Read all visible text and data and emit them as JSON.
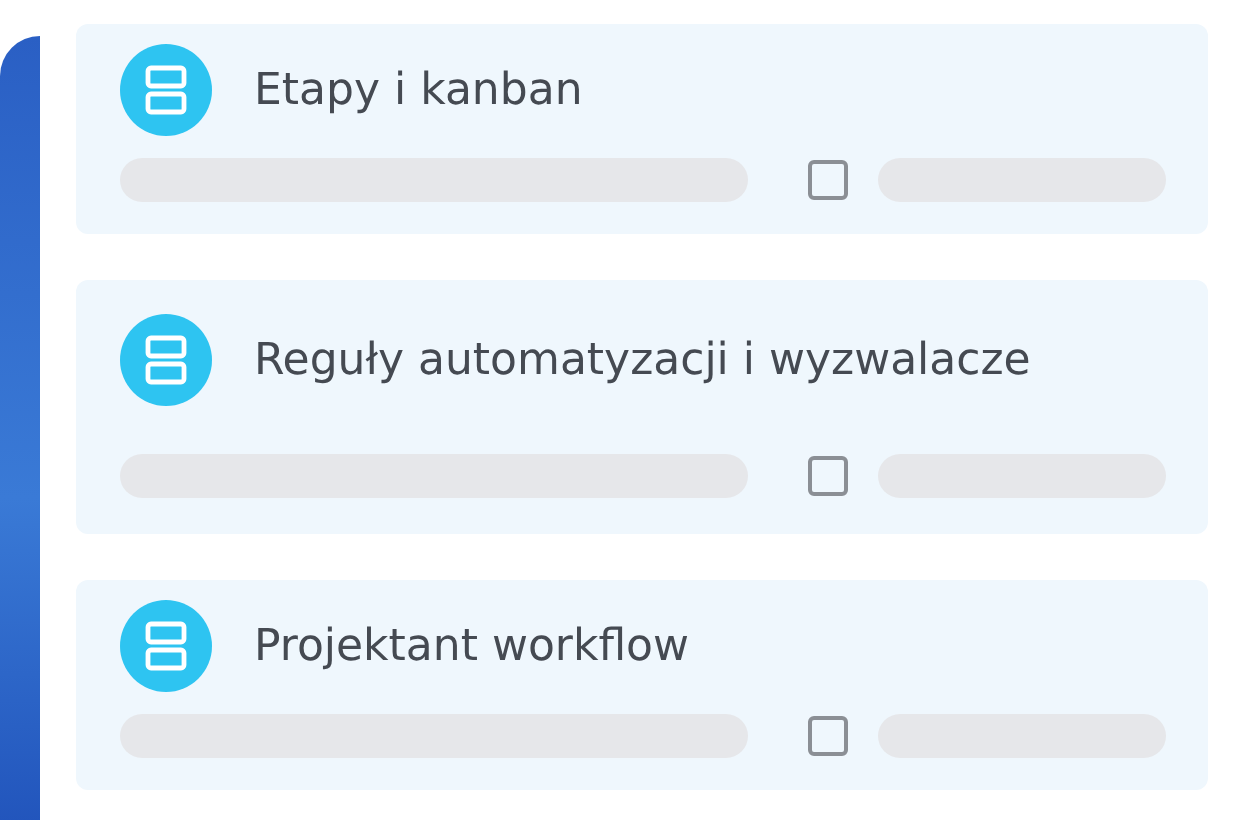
{
  "cards": [
    {
      "title": "Etapy i kanban",
      "checked": false
    },
    {
      "title": "Reguły automatyzacji i wyzwalacze",
      "checked": false
    },
    {
      "title": "Projektant workflow",
      "checked": false
    }
  ]
}
